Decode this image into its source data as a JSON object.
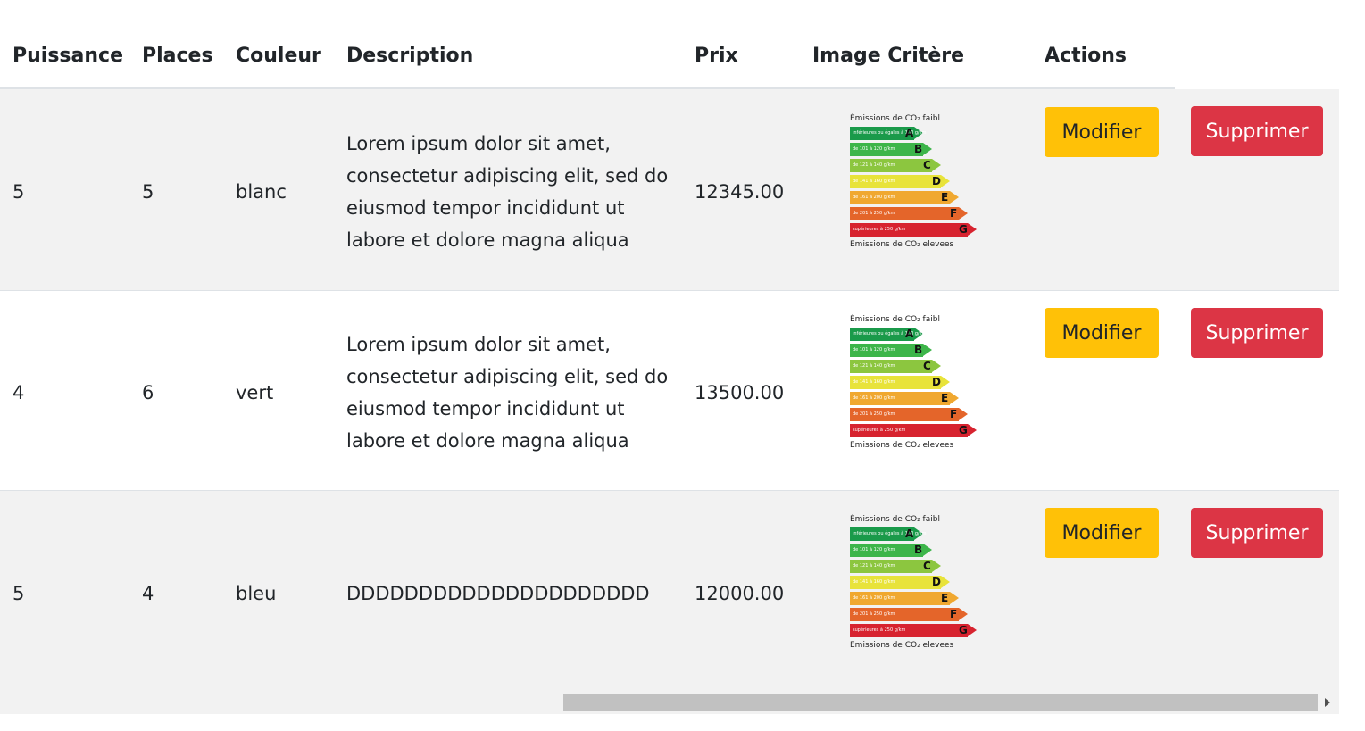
{
  "table": {
    "headers": {
      "puissance": "Puissance",
      "places": "Places",
      "couleur": "Couleur",
      "description": "Description",
      "prix": "Prix",
      "image": "Image Critère",
      "actions": "Actions"
    },
    "rows": [
      {
        "puissance": "5",
        "places": "5",
        "couleur": "blanc",
        "description": "Lorem ipsum dolor sit amet, consectetur adipiscing elit, sed do eiusmod tempor incididunt ut labore et dolore magna aliqua",
        "prix": "12345.00",
        "modifier": "Modifier",
        "supprimer": "Supprimer"
      },
      {
        "puissance": "4",
        "places": "6",
        "couleur": "vert",
        "description": "Lorem ipsum dolor sit amet, consectetur adipiscing elit, sed do eiusmod tempor incididunt ut labore et dolore magna aliqua",
        "prix": "13500.00",
        "modifier": "Modifier",
        "supprimer": "Supprimer"
      },
      {
        "puissance": "5",
        "places": "4",
        "couleur": "bleu",
        "description": "DDDDDDDDDDDDDDDDDDDDD",
        "prix": "12000.00",
        "modifier": "Modifier",
        "supprimer": "Supprimer"
      }
    ]
  },
  "energy_label": {
    "top_caption": "Émissions de CO₂ faibl",
    "bottom_caption": "Emissions de CO₂ elevees",
    "bands": [
      {
        "letter": "A",
        "label": "inférieures ou égales à 100 g/km",
        "color": "#1a9a4a"
      },
      {
        "letter": "B",
        "label": "de 101 à 120 g/km",
        "color": "#3db54a"
      },
      {
        "letter": "C",
        "label": "de 121 à 140 g/km",
        "color": "#8cc63f"
      },
      {
        "letter": "D",
        "label": "de 141 à 160 g/km",
        "color": "#e8e33a"
      },
      {
        "letter": "E",
        "label": "de 161 à 200 g/km",
        "color": "#f0a830"
      },
      {
        "letter": "F",
        "label": "de 201 à 250 g/km",
        "color": "#e4652a"
      },
      {
        "letter": "G",
        "label": "supérieures à 250 g/km",
        "color": "#d7232f"
      }
    ]
  },
  "colors": {
    "modifier_button": "#ffc107",
    "supprimer_button": "#dc3545",
    "striped_row": "#f2f2f2"
  }
}
